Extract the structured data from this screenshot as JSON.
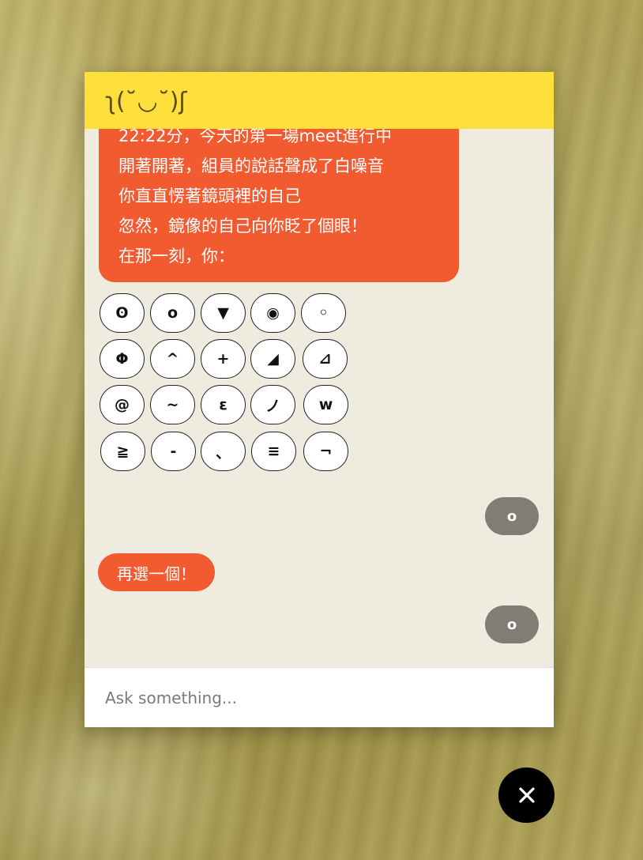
{
  "chat": {
    "title": "ʅ(˘◡˘)ʃ",
    "bot_message_lines": [
      "22:22分，今天的第一場meet進行中",
      "開著開著，組員的說話聲成了白噪音",
      "你直直愣著鏡頭裡的自己",
      "忽然，鏡像的自己向你眨了個眼！",
      "在那一刻，你："
    ],
    "options": [
      [
        "ʘ",
        "o",
        "▼",
        "◉",
        "◦"
      ],
      [
        "Φ",
        "^",
        "+",
        "◢",
        "⊿"
      ],
      [
        "@",
        "~",
        "ε",
        "ノ",
        "w"
      ],
      [
        "≧",
        "-",
        "、",
        "≡",
        "¬"
      ]
    ],
    "user_reply_1": "o",
    "bot_followup": "再選一個！",
    "user_reply_2": "o"
  },
  "input": {
    "placeholder": "Ask something..."
  },
  "close_button": {
    "icon": "close-icon"
  }
}
